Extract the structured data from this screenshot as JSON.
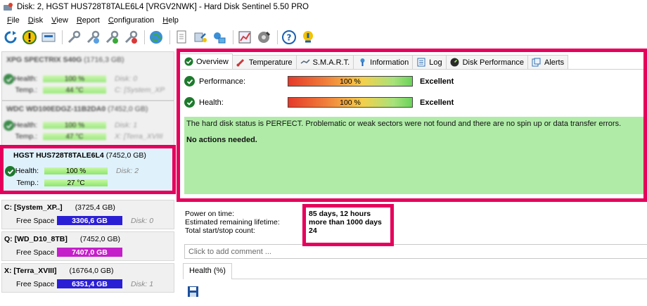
{
  "window": {
    "title": "Disk: 2, HGST HUS728T8TALE6L4 [VRGV2NWK]  -  Hard Disk Sentinel 5.50 PRO"
  },
  "menu": [
    {
      "label": "File",
      "u": "F",
      "rest": "ile"
    },
    {
      "label": "Disk",
      "u": "D",
      "rest": "isk"
    },
    {
      "label": "View",
      "u": "V",
      "rest": "iew"
    },
    {
      "label": "Report",
      "u": "R",
      "rest": "eport"
    },
    {
      "label": "Configuration",
      "u": "C",
      "rest": "onfiguration"
    },
    {
      "label": "Help",
      "u": "H",
      "rest": "elp"
    }
  ],
  "disks": [
    {
      "name": "XPG SPECTRIX S40G",
      "size": "(1716,3 GB)",
      "health_label": "Health:",
      "health": "100 %",
      "health_extra": "Disk: 0",
      "temp_label": "Temp.:",
      "temp": "44 °C",
      "temp_extra": "C: [System_XP"
    },
    {
      "name": "WDC WD100EDGZ-11B2DA0",
      "size": "(7452,0 GB)",
      "health_label": "Health:",
      "health": "100 %",
      "health_extra": "Disk: 1",
      "temp_label": "Temp.:",
      "temp": "47 °C",
      "temp_extra": "X: [Terra_XVIII"
    },
    {
      "name": "HGST HUS728T8TALE6L4",
      "size": "(7452,0 GB)",
      "health_label": "Health:",
      "health": "100 %",
      "health_extra": "Disk: 2",
      "temp_label": "Temp.:",
      "temp": "27 °C"
    }
  ],
  "partitions": [
    {
      "name": "C: [System_XP..]",
      "size": "(3725,4 GB)",
      "free_label": "Free Space",
      "free": "3306,6 GB",
      "disk": "Disk: 0",
      "color": "#2b1fd6"
    },
    {
      "name": "Q: [WD_D10_8TB]",
      "size": "(7452,0 GB)",
      "free_label": "Free Space",
      "free": "7407,0 GB",
      "disk": "",
      "color": "#c41fc9"
    },
    {
      "name": "X: [Terra_XVIII]",
      "size": "(16764,0 GB)",
      "free_label": "Free Space",
      "free": "6351,4 GB",
      "disk": "Disk: 1",
      "color": "#2b1fd6"
    }
  ],
  "tabs": [
    {
      "label": "Overview",
      "icon": "check-circle-icon"
    },
    {
      "label": "Temperature",
      "icon": "thermometer-icon"
    },
    {
      "label": "S.M.A.R.T.",
      "icon": "smart-icon"
    },
    {
      "label": "Information",
      "icon": "info-icon"
    },
    {
      "label": "Log",
      "icon": "log-icon"
    },
    {
      "label": "Disk Performance",
      "icon": "performance-icon"
    },
    {
      "label": "Alerts",
      "icon": "alerts-icon"
    }
  ],
  "overview": {
    "performance_label": "Performance:",
    "performance_value": "100 %",
    "performance_rating": "Excellent",
    "health_label": "Health:",
    "health_value": "100 %",
    "health_rating": "Excellent",
    "status_line": "The hard disk status is PERFECT. Problematic or weak sectors were not found and there are no spin up or data transfer errors.",
    "action_line": "No actions needed."
  },
  "stats": [
    {
      "key": "Power on time:",
      "value": "85 days, 12 hours"
    },
    {
      "key": "Estimated remaining lifetime:",
      "value": "more than 1000 days"
    },
    {
      "key": "Total start/stop count:",
      "value": "24"
    }
  ],
  "comment_placeholder": "Click to add comment ...",
  "health_tab": "Health (%)",
  "colors": {
    "highlight": "#e5005b",
    "status_bg": "#b0eca8",
    "health_bar": "#8de86a"
  }
}
